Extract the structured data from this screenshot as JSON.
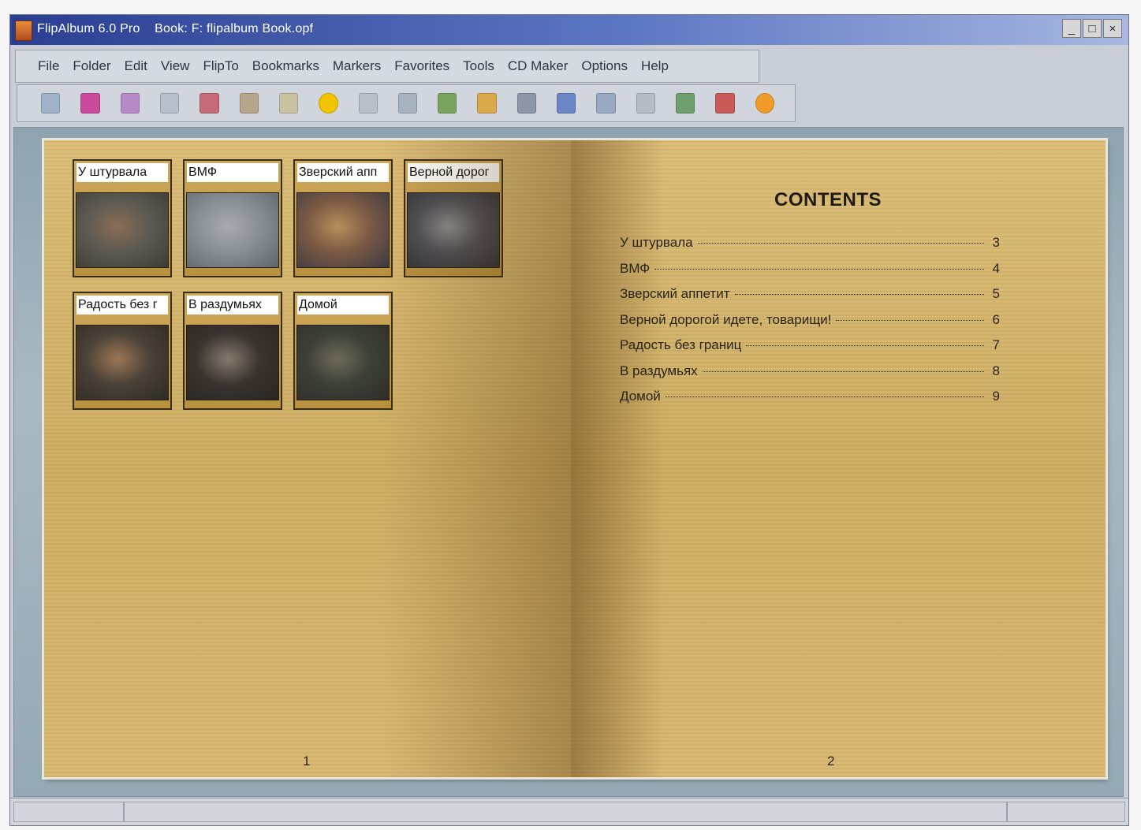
{
  "window": {
    "title": "FlipAlbum 6.0 Pro    Book: F: flipalbum Book.opf",
    "buttons": [
      "_",
      "□",
      "×"
    ]
  },
  "menu": [
    "File",
    "Folder",
    "Edit",
    "View",
    "FlipTo",
    "Bookmarks",
    "Markers",
    "Favorites",
    "Tools",
    "CD Maker",
    "Options",
    "Help"
  ],
  "toolbar": {
    "icons": [
      {
        "name": "open-book-icon",
        "color": "#9fb3c8"
      },
      {
        "name": "bookmark-icon",
        "color": "#c9499b"
      },
      {
        "name": "album-icon",
        "color": "#b68ac9"
      },
      {
        "name": "page-icon",
        "color": "#b6c0cc"
      },
      {
        "name": "photo-icon",
        "color": "#c66a78"
      },
      {
        "name": "spread-icon",
        "color": "#b7a58c"
      },
      {
        "name": "document-icon",
        "color": "#c9c2a2"
      },
      {
        "name": "add-icon",
        "color": "#f2c400"
      },
      {
        "name": "pen-icon",
        "color": "#b8bfc6"
      },
      {
        "name": "columns-icon",
        "color": "#a7b2bf"
      },
      {
        "name": "arrow-icon",
        "color": "#7aa35d"
      },
      {
        "name": "open-album-icon",
        "color": "#d9a94a"
      },
      {
        "name": "music-icon",
        "color": "#8c96a8"
      },
      {
        "name": "next-icon",
        "color": "#6b86c4"
      },
      {
        "name": "slideshow-icon",
        "color": "#9aa9c2"
      },
      {
        "name": "image-icon",
        "color": "#b7bcc4"
      },
      {
        "name": "print-icon",
        "color": "#6f9e6f"
      },
      {
        "name": "flag-icon",
        "color": "#c85a5a"
      },
      {
        "name": "help-icon",
        "color": "#f19b2b"
      }
    ]
  },
  "left_page": {
    "page_number": "1",
    "thumbnails": [
      {
        "label": "У штурвала",
        "colors": [
          "#5d5a52",
          "#8a6d55",
          "#3e3b36"
        ]
      },
      {
        "label": "ВМФ",
        "colors": [
          "#8a8f93",
          "#a7abaf",
          "#5e6569"
        ]
      },
      {
        "label": "Зверский апп",
        "colors": [
          "#7b5a44",
          "#b88e5a",
          "#3d3a44"
        ]
      },
      {
        "label": "Верной дорог",
        "colors": [
          "#4f5058",
          "#8c8d92",
          "#2f3038"
        ]
      },
      {
        "label": "Радость без г",
        "colors": [
          "#4a4238",
          "#9d7654",
          "#2f2a25"
        ]
      },
      {
        "label": "В раздумьях",
        "colors": [
          "#3a3430",
          "#857a6d",
          "#2a2522"
        ]
      },
      {
        "label": "Домой",
        "colors": [
          "#3d4038",
          "#6f6a58",
          "#2d2e28"
        ]
      }
    ]
  },
  "right_page": {
    "heading": "CONTENTS",
    "page_number": "2",
    "toc": [
      {
        "title": "У штурвала",
        "page": "3"
      },
      {
        "title": "ВМФ",
        "page": "4"
      },
      {
        "title": "Зверский аппетит",
        "page": "5"
      },
      {
        "title": "Верной дорогой идете, товарищи!",
        "page": "6"
      },
      {
        "title": "Радость без границ",
        "page": "7"
      },
      {
        "title": "В раздумьях",
        "page": "8"
      },
      {
        "title": "Домой",
        "page": "9"
      }
    ]
  }
}
